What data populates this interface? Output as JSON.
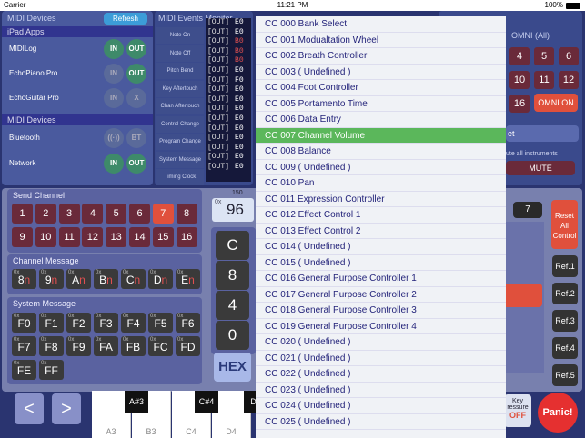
{
  "status": {
    "carrier": "Carrier",
    "time": "11:21 PM",
    "battery": "100%"
  },
  "midi_devices_panel": {
    "title": "MIDI Devices",
    "refresh": "Refresh",
    "ipad_apps_header": "iPad Apps",
    "apps": [
      {
        "name": "MIDILog",
        "in": "IN",
        "out": "OUT"
      },
      {
        "name": "EchoPiano Pro",
        "in": "IN",
        "out": "OUT"
      },
      {
        "name": "EchoGuitar Pro",
        "in": "IN",
        "out": "X"
      }
    ],
    "devices_header": "MIDI Devices",
    "devices": [
      {
        "name": "Bluetooth",
        "in": "((·))",
        "out": "BT"
      },
      {
        "name": "Network",
        "in": "IN",
        "out": "OUT"
      }
    ]
  },
  "monitor": {
    "title": "MIDI Events Monitor",
    "labels": [
      "Note On",
      "Note Off",
      "Pitch Bend",
      "Key Aftertouch",
      "Chan Aftertouch",
      "Control Change",
      "Program Change",
      "System Message",
      "Timing Clock"
    ],
    "log": [
      {
        "d": "[OUT]",
        "c": "E0"
      },
      {
        "d": "[OUT]",
        "c": "E0"
      },
      {
        "d": "[OUT]",
        "c": "B0"
      },
      {
        "d": "[OUT]",
        "c": "B0"
      },
      {
        "d": "[OUT]",
        "c": "B0"
      },
      {
        "d": "[OUT]",
        "c": "E0"
      },
      {
        "d": "[OUT]",
        "c": "F0"
      },
      {
        "d": "[OUT]",
        "c": "E0"
      },
      {
        "d": "[OUT]",
        "c": "E0"
      },
      {
        "d": "[OUT]",
        "c": "E0"
      },
      {
        "d": "[OUT]",
        "c": "E0"
      },
      {
        "d": "[OUT]",
        "c": "E0"
      },
      {
        "d": "[OUT]",
        "c": "E0"
      },
      {
        "d": "[OUT]",
        "c": "E0"
      },
      {
        "d": "[OUT]",
        "c": "E0"
      },
      {
        "d": "[OUT]",
        "c": "E0"
      }
    ]
  },
  "send": {
    "title": "Send Channel",
    "channels": [
      "1",
      "2",
      "3",
      "4",
      "5",
      "6",
      "7",
      "8",
      "9",
      "10",
      "11",
      "12",
      "13",
      "14",
      "15",
      "16"
    ],
    "selected_index": 6,
    "channel_msg_title": "Channel Message",
    "ch_msgs": [
      {
        "a": "8",
        "b": "n"
      },
      {
        "a": "9",
        "b": "n"
      },
      {
        "a": "A",
        "b": "n"
      },
      {
        "a": "B",
        "b": "n"
      },
      {
        "a": "C",
        "b": "n"
      },
      {
        "a": "D",
        "b": "n"
      },
      {
        "a": "E",
        "b": "n"
      }
    ],
    "sys_msg_title": "System Message",
    "sys_msgs": [
      "F0",
      "F1",
      "F2",
      "F3",
      "F4",
      "F5",
      "F6",
      "F7",
      "F8",
      "F9",
      "FA",
      "FB",
      "FC",
      "FD",
      "FE",
      "FF"
    ],
    "ox": "0x"
  },
  "display": {
    "top": "150",
    "prefix": "0x",
    "value": "96"
  },
  "keypad": [
    "C",
    "8",
    "4",
    "0"
  ],
  "hex": "HEX",
  "dropdown": [
    "CC 000  Bank Select",
    "CC 001  Modualtation Wheel",
    "CC 002  Breath Controller",
    "CC 003  ( Undefined )",
    "CC 004  Foot Controller",
    "CC 005  Portamento Time",
    "CC 006  Data Entry",
    "CC 007  Channel Volume",
    "CC 008  Balance",
    "CC 009  ( Undefined )",
    "CC 010  Pan",
    "CC 011  Expression Controller",
    "CC 012  Effect Control 1",
    "CC 013  Effect Control 2",
    "CC 014  ( Undefined )",
    "CC 015  ( Undefined )",
    "CC 016  General Purpose Controller 1",
    "CC 017  General Purpose Controller 2",
    "CC 018  General Purpose Controller 3",
    "CC 019  General Purpose Controller 4",
    "CC 020  ( Undefined )",
    "CC 021  ( Undefined )",
    "CC 022  ( Undefined )",
    "CC 023  ( Undefined )",
    "CC 024  ( Undefined )",
    "CC 025  ( Undefined )"
  ],
  "dropdown_selected": 7,
  "right": {
    "omni_label": "OMNI (All)",
    "grid": [
      "4",
      "5",
      "6",
      "10",
      "11",
      "12",
      "16"
    ],
    "omni_on": "OMNI ON",
    "reset_partial": "et",
    "mute_note": "ute all instruments",
    "mute": "MUTE",
    "value_7": "7",
    "reset_all": "Reset All Control",
    "refs": [
      "Ref.1",
      "Ref.2",
      "Ref.3",
      "Ref.4",
      "Ref.5"
    ],
    "key_pressure": "Key",
    "pressure": "ressure",
    "pressure_off": "OFF",
    "panic": "Panic!"
  },
  "piano": {
    "prev": "<",
    "next": ">",
    "white": [
      "A3",
      "B3",
      "C4",
      "D4"
    ],
    "black": [
      "A#3",
      "C#4",
      "D#"
    ]
  }
}
